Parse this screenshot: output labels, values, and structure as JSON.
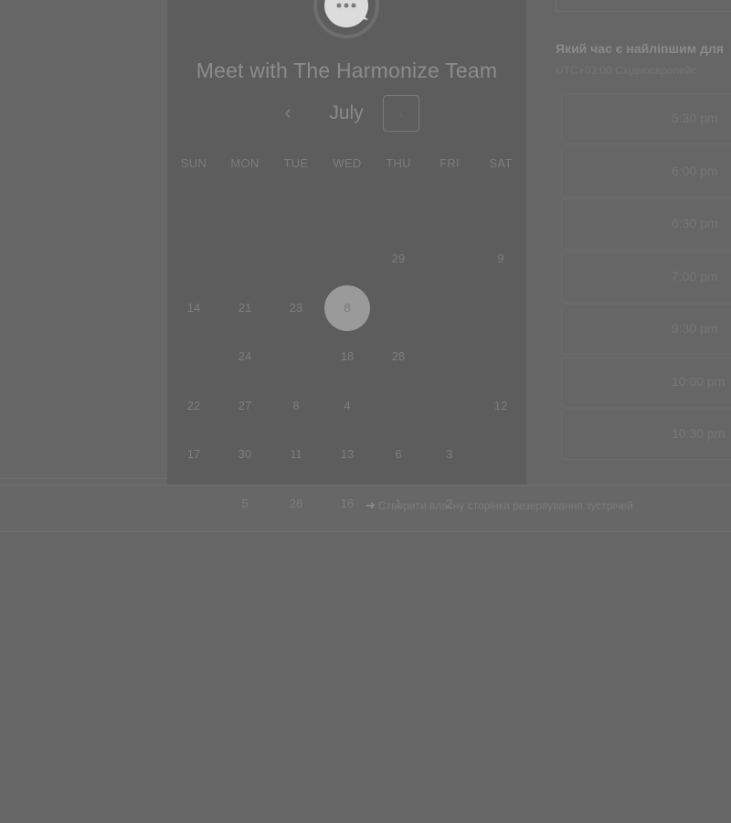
{
  "card": {
    "title": "Meet with The Harmonize Team",
    "avatar_icon": "chat-bubble-icon",
    "month": "July",
    "prev_icon": "chevron-left-icon",
    "next_icon": "chevron-right-icon",
    "weekdays": [
      "SUN",
      "MON",
      "TUE",
      "WED",
      "THU",
      "FRI",
      "SAT"
    ],
    "days": [
      {
        "row": 0,
        "col": 4,
        "label": "29"
      },
      {
        "row": 0,
        "col": 6,
        "label": "9"
      },
      {
        "row": 1,
        "col": 0,
        "label": "14"
      },
      {
        "row": 1,
        "col": 1,
        "label": "21"
      },
      {
        "row": 1,
        "col": 2,
        "label": "23"
      },
      {
        "row": 1,
        "col": 3,
        "label": "8",
        "selected": true
      },
      {
        "row": 2,
        "col": 1,
        "label": "24"
      },
      {
        "row": 2,
        "col": 3,
        "label": "18"
      },
      {
        "row": 2,
        "col": 4,
        "label": "28"
      },
      {
        "row": 3,
        "col": 0,
        "label": "22"
      },
      {
        "row": 3,
        "col": 1,
        "label": "27"
      },
      {
        "row": 3,
        "col": 2,
        "label": "8"
      },
      {
        "row": 3,
        "col": 3,
        "label": "4"
      },
      {
        "row": 3,
        "col": 6,
        "label": "12"
      },
      {
        "row": 4,
        "col": 0,
        "label": "17"
      },
      {
        "row": 4,
        "col": 1,
        "label": "30"
      },
      {
        "row": 4,
        "col": 2,
        "label": "11"
      },
      {
        "row": 4,
        "col": 3,
        "label": "13"
      },
      {
        "row": 4,
        "col": 4,
        "label": "6"
      },
      {
        "row": 4,
        "col": 5,
        "label": "3"
      },
      {
        "row": 5,
        "col": 1,
        "label": "5"
      },
      {
        "row": 5,
        "col": 2,
        "label": "26"
      },
      {
        "row": 5,
        "col": 3,
        "label": "16"
      },
      {
        "row": 5,
        "col": 4,
        "label": "1"
      },
      {
        "row": 5,
        "col": 5,
        "label": "2"
      }
    ]
  },
  "right_panel": {
    "question": "Який час є найліпшим для",
    "timezone": "UTC+03:00 Східноєвропейс",
    "slots": [
      "5:30 pm",
      "6:00 pm",
      "6:30 pm",
      "7:00 pm",
      "9:30 pm",
      "10:00 pm",
      "10:30 pm"
    ]
  },
  "footer": {
    "link_icon": "arrow-right-icon",
    "link_text": "Створити власну сторінка резервування зустрічей"
  }
}
